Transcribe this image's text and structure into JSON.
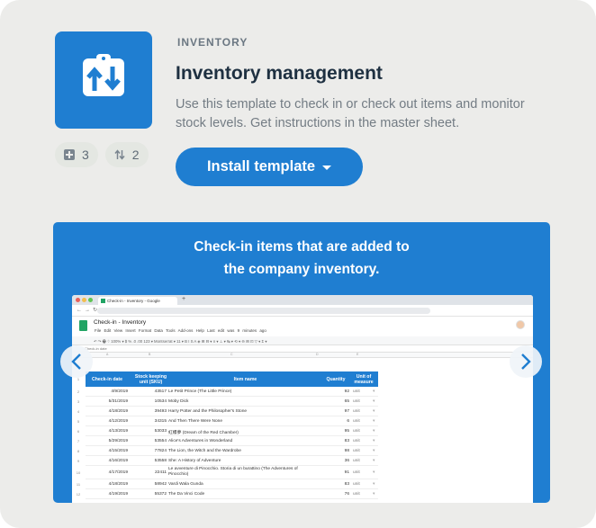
{
  "template": {
    "category": "INVENTORY",
    "title": "Inventory management",
    "description": "Use this template to check in or check out items and monitor stock levels. Get instructions in the master sheet.",
    "install_label": "Install template",
    "icon": "swap-arrows-clipboard-icon",
    "stats": {
      "tables": {
        "icon": "table-plus-icon",
        "count": "3"
      },
      "automations": {
        "icon": "sync-arrows-icon",
        "count": "2"
      }
    }
  },
  "colors": {
    "brand_blue": "#1f7ed1",
    "card_bg": "#ececea",
    "title_text": "#1e3041",
    "body_text": "#737c84"
  },
  "preview": {
    "caption_line1": "Check-in items that are added to",
    "caption_line2": "the company inventory.",
    "prev_icon": "chevron-left-icon",
    "next_icon": "chevron-right-icon",
    "screenshot": {
      "tab_title": "Check-in - Inventory - Google",
      "doc_title": "Check-in - Inventory",
      "menu": "File  Edit  View  Insert  Format  Data  Tools  Add-ons  Help   Last edit was 9 minutes ago",
      "toolbar": "↶ ↷ 🖶 ⌖   100% ▾   $  %  .0  .00  123 ▾   Montserrat ▾   11 ▾   B  I  S  A   ◈  ⊞  ⊟ ▾   ≡ ▾  ⊥ ▾  ↹ ▾  ⟲ ▾   ⊖  ⊞  ⊡  ▽ ▾  Σ ▾",
      "fx": "Check-in date",
      "columns": [
        "A",
        "B",
        "C",
        "D",
        "E"
      ],
      "headers": {
        "date": "Check-in date",
        "sku": "Stock keeping unit (SKU)",
        "name": "Item name",
        "qty": "Quantity",
        "unit": "Unit of measure"
      },
      "rows": [
        {
          "n": "2",
          "date": "4/9/2019",
          "sku": "43517",
          "name": "Le Petit Prince (The Little Prince)",
          "qty": "92",
          "unit": "unit"
        },
        {
          "n": "3",
          "date": "5/31/2019",
          "sku": "10534",
          "name": "Moby Dick",
          "qty": "65",
          "unit": "unit"
        },
        {
          "n": "4",
          "date": "4/18/2019",
          "sku": "39493",
          "name": "Harry Potter and the Philosopher's Stone",
          "qty": "97",
          "unit": "unit"
        },
        {
          "n": "5",
          "date": "4/12/2019",
          "sku": "34315",
          "name": "And Then There Were None",
          "qty": "6",
          "unit": "unit"
        },
        {
          "n": "6",
          "date": "4/13/2019",
          "sku": "53033",
          "name": "紅樓夢 (Dream of the Red Chamber)",
          "qty": "95",
          "unit": "unit"
        },
        {
          "n": "7",
          "date": "5/29/2019",
          "sku": "53554",
          "name": "Alice's Adventures in Wonderland",
          "qty": "83",
          "unit": "unit"
        },
        {
          "n": "8",
          "date": "4/15/2019",
          "sku": "77824",
          "name": "The Lion, the Witch and the Wardrobe",
          "qty": "98",
          "unit": "unit"
        },
        {
          "n": "9",
          "date": "4/16/2019",
          "sku": "53558",
          "name": "She: A History of Adventure",
          "qty": "36",
          "unit": "unit"
        },
        {
          "n": "10",
          "date": "4/17/2019",
          "sku": "22411",
          "name": "Le avventure di Pinocchio. Storia di un burattino (The Adventures of Pinocchio)",
          "qty": "91",
          "unit": "unit"
        },
        {
          "n": "11",
          "date": "4/18/2019",
          "sku": "58942",
          "name": "Vardi Wala Gunda",
          "qty": "83",
          "unit": "unit"
        },
        {
          "n": "12",
          "date": "4/19/2019",
          "sku": "55372",
          "name": "The Da Vinci Code",
          "qty": "76",
          "unit": "unit"
        }
      ]
    }
  }
}
